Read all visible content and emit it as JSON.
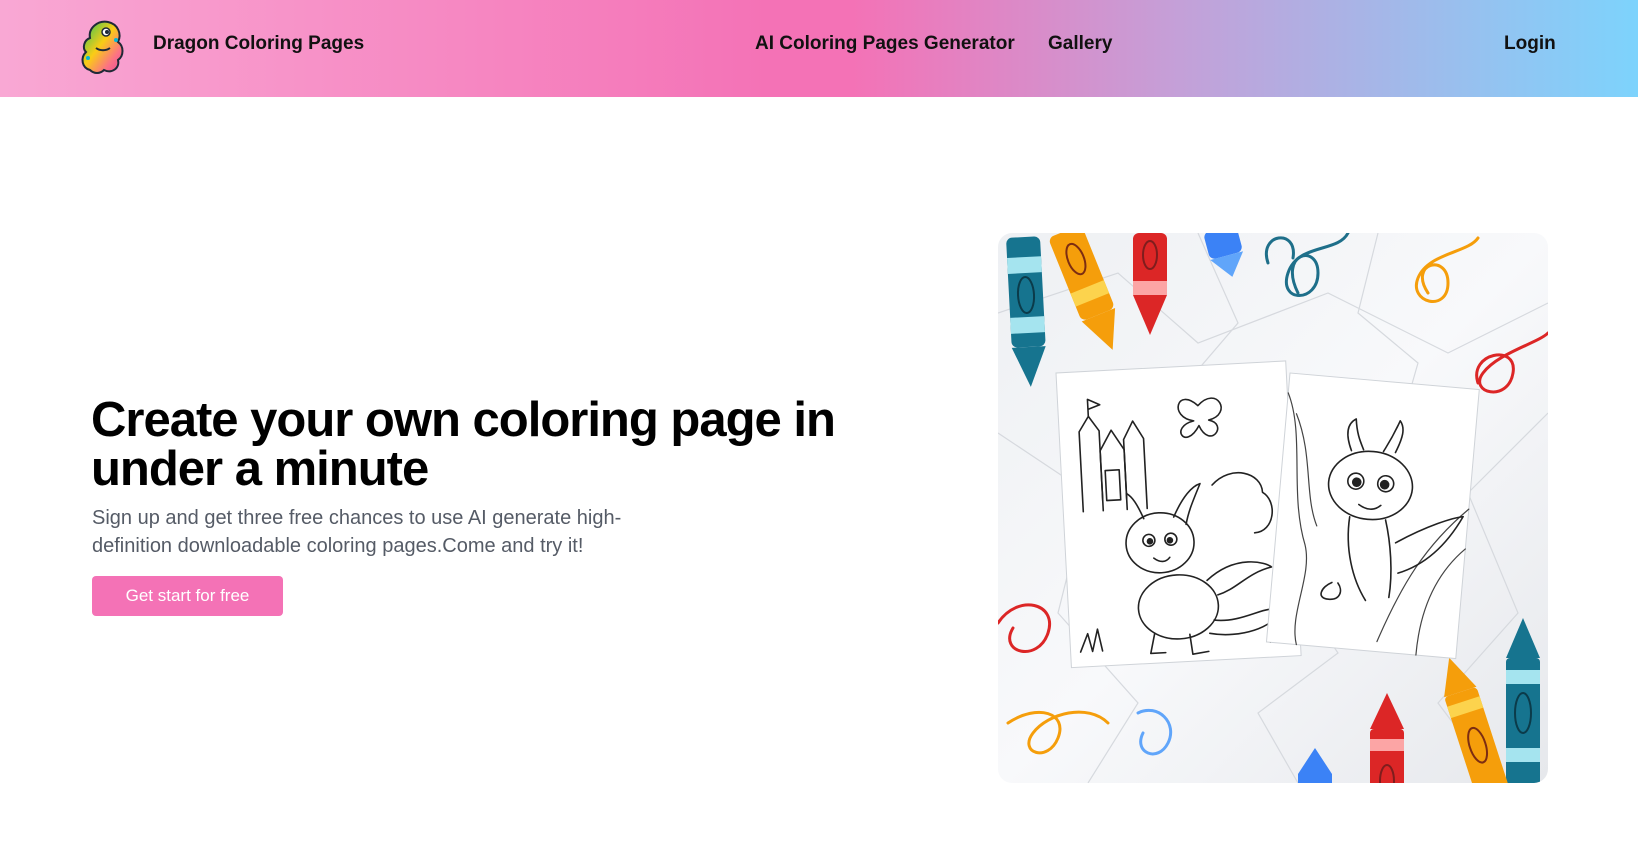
{
  "header": {
    "site_name": "Dragon Coloring Pages",
    "logo_icon": "dragon-logo-icon",
    "nav": [
      {
        "label": "AI Coloring Pages Generator"
      },
      {
        "label": "Gallery"
      }
    ],
    "login_label": "Login"
  },
  "hero": {
    "title": "Create your own coloring page in under a minute",
    "subtitle": "Sign up and get three free chances to use AI generate high-definition downloadable coloring pages.Come and try it!",
    "cta_label": "Get start for free",
    "image_icon": "coloring-pages-crayons-illustration"
  },
  "colors": {
    "accent": "#f472b6",
    "header_gradient_start": "#f9a8d4",
    "header_gradient_end": "#7dd3fc",
    "subtitle_text": "#555b66"
  }
}
